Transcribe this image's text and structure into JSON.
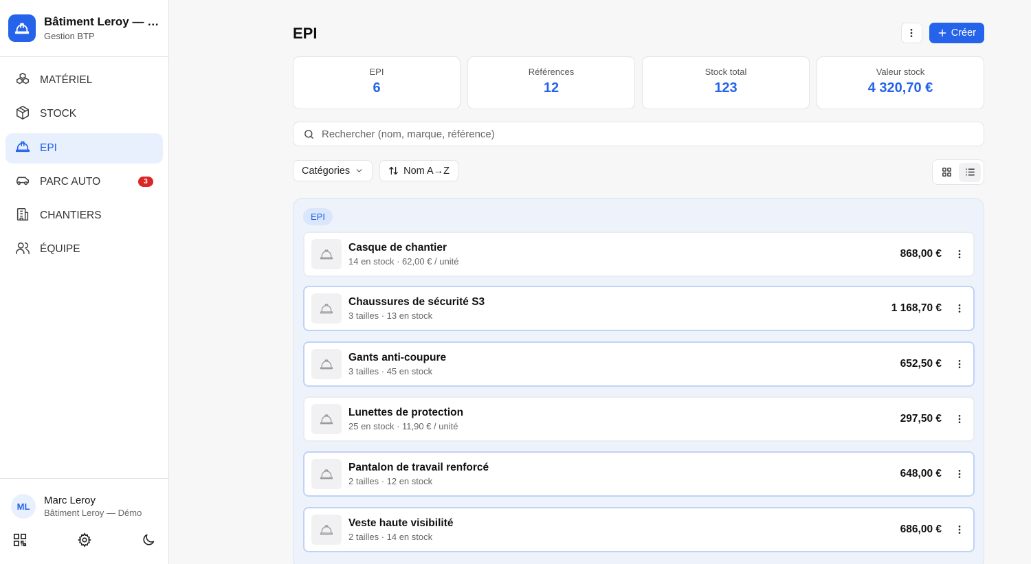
{
  "brand": {
    "title": "Bâtiment Leroy — Démo",
    "subtitle": "Gestion BTP",
    "icon": "hard-hat-icon"
  },
  "nav": {
    "items": [
      {
        "label": "MATÉRIEL",
        "icon": "boxes-icon"
      },
      {
        "label": "STOCK",
        "icon": "package-icon"
      },
      {
        "label": "EPI",
        "icon": "hard-hat-icon",
        "active": true
      },
      {
        "label": "PARC AUTO",
        "icon": "car-icon",
        "badge": "3"
      },
      {
        "label": "CHANTIERS",
        "icon": "building-icon"
      },
      {
        "label": "ÉQUIPE",
        "icon": "users-icon"
      }
    ]
  },
  "user": {
    "initials": "ML",
    "name": "Marc Leroy",
    "org": "Bâtiment Leroy — Démo"
  },
  "footer_icons": [
    "qr-code-icon",
    "gear-icon",
    "moon-icon"
  ],
  "header": {
    "title": "EPI",
    "create_label": "Créer"
  },
  "stats": [
    {
      "label": "EPI",
      "value": "6"
    },
    {
      "label": "Références",
      "value": "12"
    },
    {
      "label": "Stock total",
      "value": "123"
    },
    {
      "label": "Valeur stock",
      "value": "4 320,70 €"
    }
  ],
  "search": {
    "placeholder": "Rechercher (nom, marque, référence)"
  },
  "filters": {
    "categories_label": "Catégories",
    "sort_label": "Nom A→Z"
  },
  "group": {
    "tag": "EPI",
    "items": [
      {
        "name": "Casque de chantier",
        "sub": "14 en stock · 62,00 € / unité",
        "price": "868,00 €"
      },
      {
        "name": "Chaussures de sécurité S3",
        "sub": "3 tailles · 13 en stock",
        "price": "1 168,70 €"
      },
      {
        "name": "Gants anti-coupure",
        "sub": "3 tailles · 45 en stock",
        "price": "652,50 €"
      },
      {
        "name": "Lunettes de protection",
        "sub": "25 en stock · 11,90 € / unité",
        "price": "297,50 €"
      },
      {
        "name": "Pantalon de travail renforcé",
        "sub": "2 tailles · 12 en stock",
        "price": "648,00 €"
      },
      {
        "name": "Veste haute visibilité",
        "sub": "2 tailles · 14 en stock",
        "price": "686,00 €"
      }
    ]
  },
  "colors": {
    "accent": "#2563eb",
    "badge": "#dc2626"
  }
}
